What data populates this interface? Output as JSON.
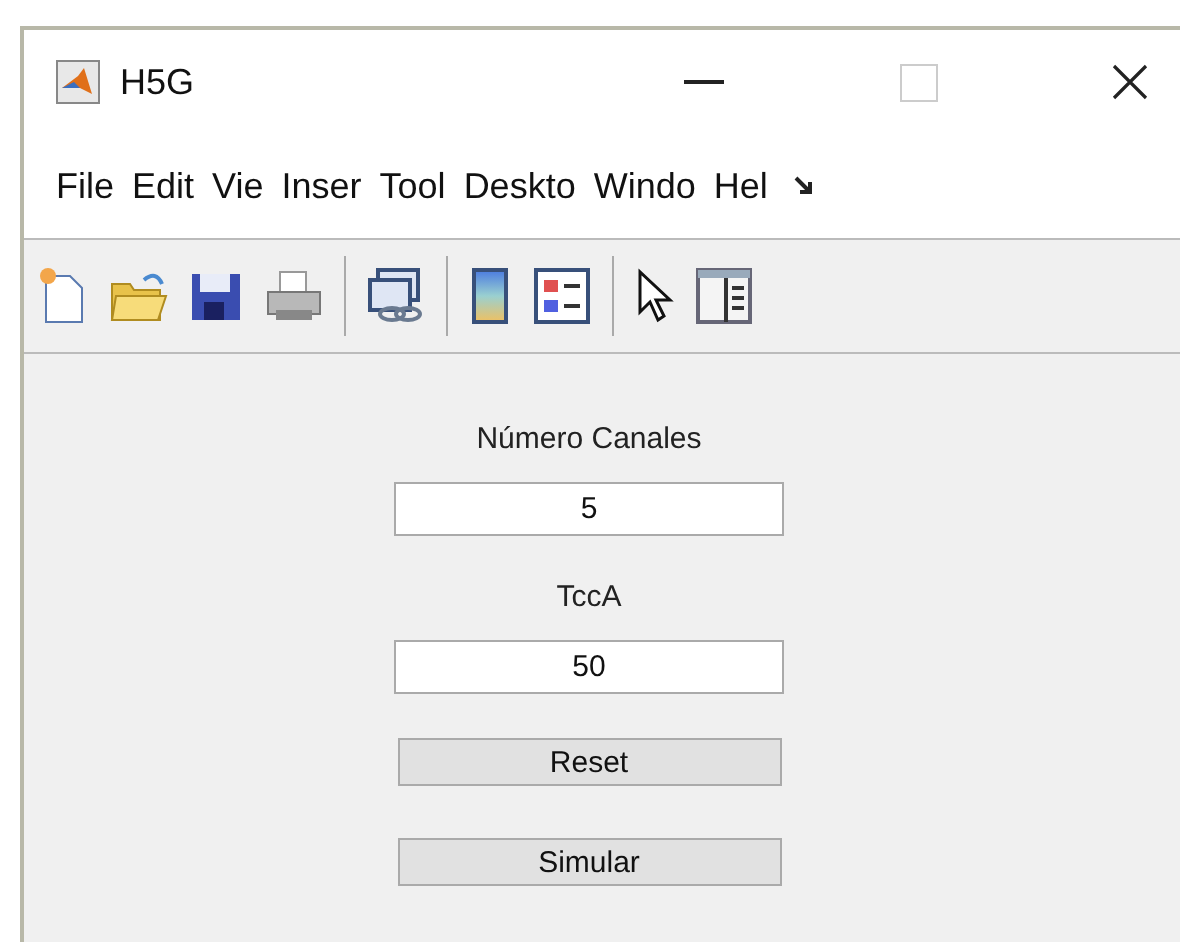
{
  "window": {
    "title": "H5G"
  },
  "menu": [
    "File",
    "Edit",
    "Vie",
    "Inser",
    "Tool",
    "Deskto",
    "Windo",
    "Hel"
  ],
  "form": [
    {
      "kind": "label",
      "text": "Número Canales"
    },
    {
      "kind": "field",
      "value": "5"
    },
    {
      "kind": "label",
      "text": "TccA"
    },
    {
      "kind": "field",
      "value": "50"
    },
    {
      "kind": "button",
      "text": "Reset"
    },
    {
      "kind": "button",
      "text": "Simular"
    }
  ]
}
